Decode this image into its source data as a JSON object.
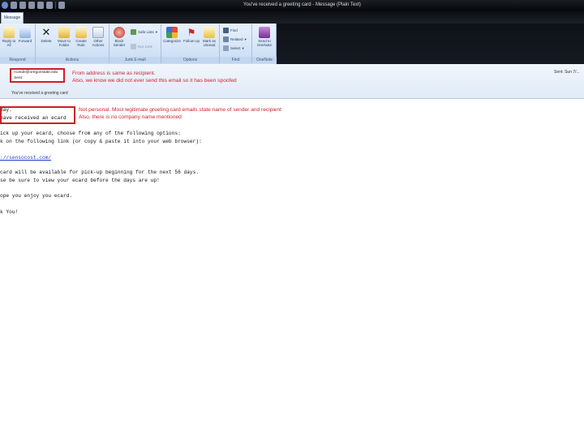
{
  "window": {
    "title": "You've received a greeting card - Message (Plain Text)"
  },
  "ribbon": {
    "active_tab": "Message",
    "groups": {
      "respond": {
        "label": "Respond",
        "reply_all": "Reply to All",
        "forward": "Forward"
      },
      "actions": {
        "label": "Actions",
        "delete": "Delete",
        "move_to_folder": "Move to Folder",
        "create_rule": "Create Rule",
        "other_actions": "Other Actions"
      },
      "junk": {
        "label": "Junk E-mail",
        "block_sender": "Block Sender",
        "safe_lists": "Safe Lists",
        "not_junk": "Not Junk"
      },
      "options": {
        "label": "Options",
        "categorize": "Categorize",
        "follow_up": "Follow Up",
        "mark_as_unread": "Mark as Unread"
      },
      "find": {
        "label": "Find",
        "find": "Find",
        "related": "Related",
        "select": "Select"
      },
      "onenote": {
        "label": "OneNote",
        "send_to_onenote": "Send to OneNote"
      }
    }
  },
  "header": {
    "from_line1": "rconde@oregonstate.edu",
    "from_line2": "Sent:",
    "sent_label": "Sent: Sun 7/...",
    "subject": "You've received a greeting card",
    "annotation_from": [
      "From address is same as recipient.",
      "Also, we know we did not ever send this email so it has been spoofed"
    ]
  },
  "body": {
    "lines": [
      "day.",
      "have received an ecard",
      "ick up your ecard, choose from any of the following options:",
      "k on the following link (or copy & paste it into your web browser):",
      "://sensocost.com/",
      "card will be available for pick-up beginning for the next 56 days.",
      "se be sure to view your ecard before the days are up!",
      "ope you enjoy you ecard.",
      "k You!"
    ],
    "annotation_personal": [
      "Not personal. Most legitimate greeting card emails state name of sender and recipient",
      "Also, there is no company name mentioned"
    ]
  },
  "colors": {
    "annotation_red": "#d11f2e",
    "ribbon_blue": "#c9dcf3",
    "titlebar_dark": "#05070a"
  }
}
